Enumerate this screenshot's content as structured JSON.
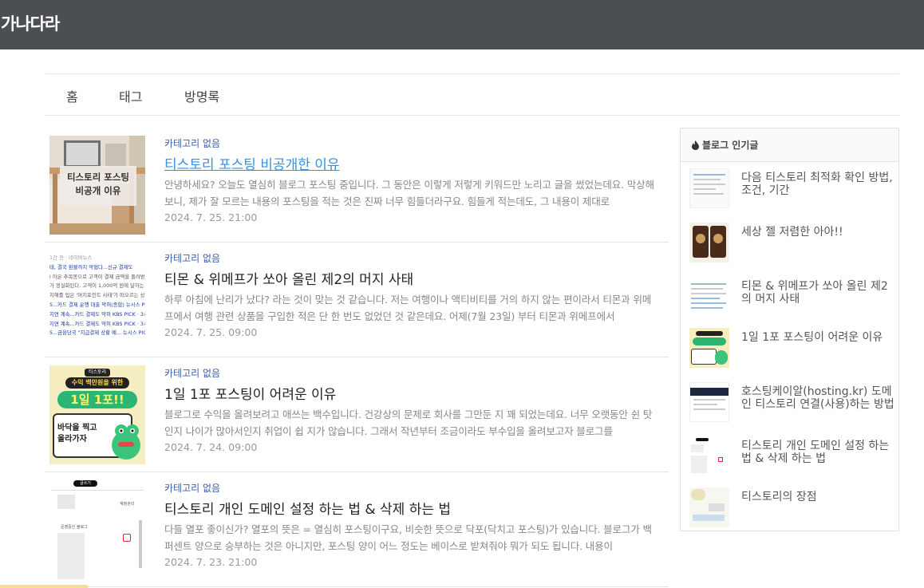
{
  "header": {
    "site_title": "가나다라"
  },
  "nav": {
    "items": [
      "홈",
      "태그",
      "방명록"
    ]
  },
  "posts": [
    {
      "category": "카테고리 없음",
      "title": "티스토리 포스팅 비공개한 이유",
      "excerpt": "안녕하세요? 오늘도 열심히 블로그 포스팅 중입니다. 그 동안은 이렇게 저렇게 키워드만 노리고 글을 썼었는데요. 막상해보니, 제가 잘 모르는 내용의 포스팅을 적는 것은 진짜 너무 힘들더라구요. 힘들게 적는데도, 그 내용이 제대로",
      "date": "2024. 7. 25. 21:00",
      "thumb_text": "티스토리 포스팅\n비공개 이유"
    },
    {
      "category": "카테고리 없음",
      "title": "티몬 & 위메프가 쏘아 올린 제2의 머지 사태",
      "excerpt": "하루 아침에 난리가 났다? 라는 것이 맞는 것 같습니다. 저는 여행이나 액티비티를 거의 하지 않는 편이라서 티몬과 위메프에서 여행 관련 상품을 구입한 적은 단 한 번도 없었던 것 같은데요.   어제(7월 23일) 부터 티몬과 위메프에서",
      "date": "2024. 7. 25. 09:00",
      "thumb_lines": [
        "1간 전 · 네이버뉴스",
        "태, 결국 환불까지 막혔다...신규 결제도",
        "l 아온 추목봉으로 고객이 결제 금액을 돌려받",
        "가 정실화된다. 고객이 1,000억 원에 달하는",
        "지해를 입은 '머지포인트 사태'가 떠오르는 상",
        "5...카드 결제 운행 대출 막혀(종합) 뉴시스 PICK",
        "지연 계속...카드 결제도 막혀 KBS PICK · 3시간",
        "지연 계속...카드 결제도 막혀 KBS PICK · 3시간",
        "5...금융당국 \"지급결제 상황 예... 뉴시스 PICK"
      ]
    },
    {
      "category": "카테고리 없음",
      "title": "1일 1포 포스팅이 어려운 이유",
      "excerpt": "블로그로 수익을 올려보려고 애쓰는 백수입니다.  건강상의 문제로 회사를 그만둔 지 꽤 되었는데요. 너무 오랫동안 쉰 탓인지 나이가 많아서인지 취업이 쉽 지가 않습니다. 그래서 작년부터 조금이라도 부수입을 올려보고자 블로그를",
      "date": "2024. 7. 24. 09:00",
      "thumb_badge": "티스토리",
      "thumb_sub": "수익 백만원을 위한",
      "thumb_big": "1일 1포!!",
      "thumb_box": "바닥을 찍고\n올라가자"
    },
    {
      "category": "카테고리 없음",
      "title": "티스토리 개인 도메인 설정 하는 법 & 삭제 하는 법",
      "excerpt": "다들 열포 좋이신가? 열포의 뜻은 = 열심히 포스팅이구요, 비슷한 뜻으로 닥포(닥치고 포스팅)가 있습니다.  블로그가 백퍼센트 양으로 승부하는 것은 아니지만, 포스팅 양이 어느 정도는 베이스로 받쳐줘야 뭐가 되도 됩니다. 내용이",
      "date": "2024. 7. 23. 21:00",
      "thumb_top": "글쓰기",
      "thumb_manage": "계정관리",
      "thumb_list": "운영중인 블로그"
    }
  ],
  "sidebar": {
    "heading": "블로그 인기글",
    "icon": "fire-icon",
    "items": [
      "다음 티스토리 최적화 확인 방법, 조건, 기간",
      "세상 젤 저렴한 아아!!",
      "티몬 & 위메프가 쏘아 올린 제2의 머지 사태",
      "1일 1포 포스팅이 어려운 이유",
      "호스팅케이알(hosting.kr) 도메인 티스토리 연결(사용)하는 방법",
      "티스토리 개인 도메인 설정 하는 법 & 삭제 하는 법",
      "티스토리의 장점"
    ]
  },
  "colors": {
    "header_bg": "#4b4f54",
    "link_hover": "#3a8fe0",
    "category": "#3a5eae",
    "accent_green": "#2bb673"
  }
}
